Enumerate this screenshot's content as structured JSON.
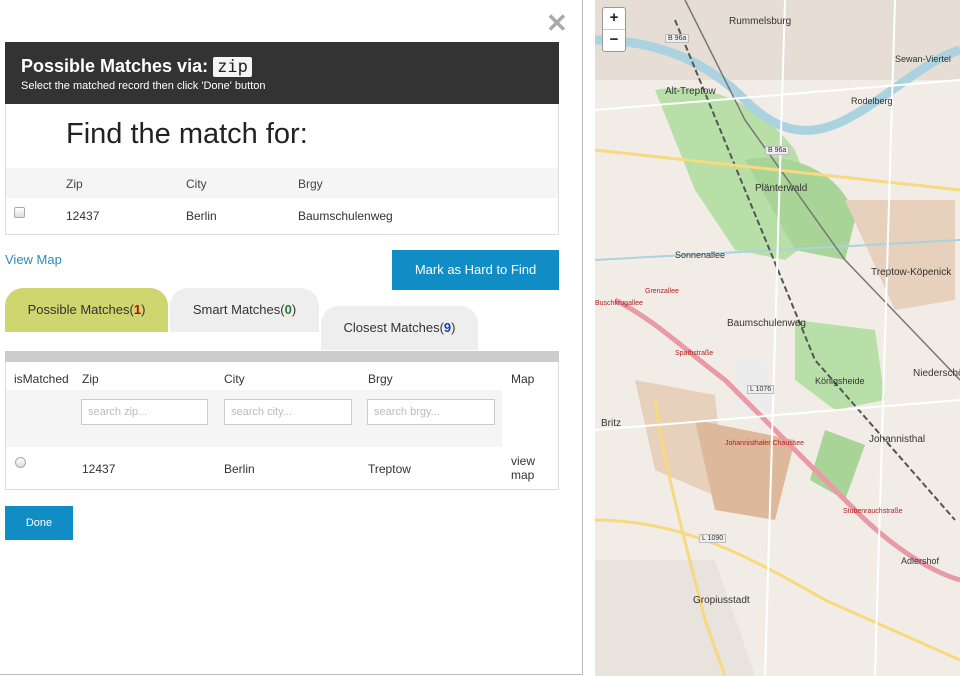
{
  "header": {
    "title_prefix": "Possible Matches via:",
    "title_code": "zip",
    "subtitle": "Select the matched record then click 'Done' button"
  },
  "find": {
    "title": "Find the match for:",
    "columns": [
      "Zip",
      "City",
      "Brgy"
    ],
    "row": {
      "zip": "12437",
      "city": "Berlin",
      "brgy": "Baumschulenweg"
    }
  },
  "actions": {
    "view_map": "View Map",
    "mark_hard": "Mark as Hard to Find",
    "done": "Done"
  },
  "tabs": {
    "possible": {
      "label": "Possible Matches",
      "count": "1"
    },
    "smart": {
      "label": "Smart Matches",
      "count": "0"
    },
    "closest": {
      "label": "Closest Matches",
      "count": "9"
    }
  },
  "results": {
    "columns": {
      "isMatched": "isMatched",
      "zip": "Zip",
      "city": "City",
      "brgy": "Brgy",
      "map": "Map"
    },
    "filters": {
      "zip": "search zip...",
      "city": "search city...",
      "brgy": "search brgy..."
    },
    "rows": [
      {
        "zip": "12437",
        "city": "Berlin",
        "brgy": "Treptow",
        "map_link_1": "view",
        "map_link_2": "map"
      }
    ]
  },
  "map": {
    "zoom_in": "+",
    "zoom_out": "−",
    "labels": [
      "Rummelsburg",
      "Alt-Treptow",
      "Plänterwald",
      "Treptow-Köpenick",
      "Baumschulenweg",
      "Britz",
      "Johannisthal",
      "Niederschö",
      "Gropiusstadt",
      "Rodelberg",
      "Sonnenallee",
      "Königsheide",
      "Sewan-Viertel",
      "Adlershof"
    ],
    "street_labels": [
      "Spathstraße",
      "Stubenrauchstraße",
      "Johannisthaler Chaussee",
      "Grenzallee",
      "Buschkrugallee"
    ],
    "road_labels": [
      "B 96a",
      "B 96a",
      "L 1076",
      "L 1090"
    ]
  }
}
